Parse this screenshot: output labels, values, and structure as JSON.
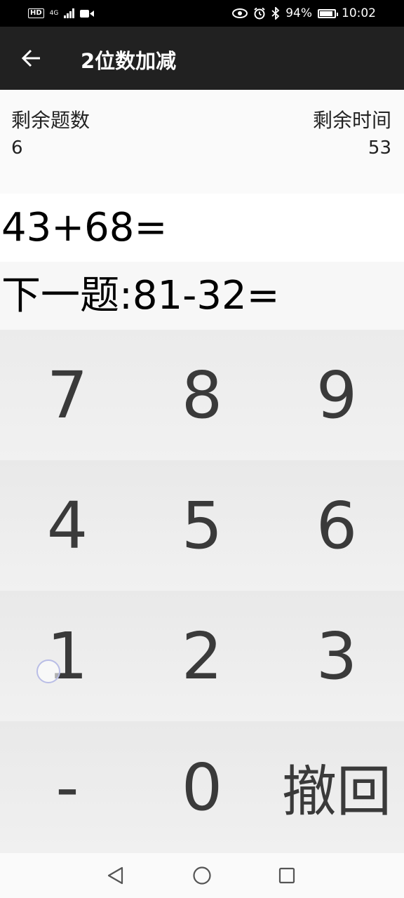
{
  "status_bar": {
    "hd": "HD",
    "network": "4G",
    "battery": "94%",
    "time": "10:02",
    "icons": [
      "signal-icon",
      "video-icon",
      "eye-icon",
      "alarm-icon",
      "bluetooth-icon",
      "battery-icon"
    ]
  },
  "toolbar": {
    "title": "2位数加减",
    "back_icon": "arrow-left-icon"
  },
  "info": {
    "remaining_questions_label": "剩余题数",
    "remaining_questions_value": "6",
    "remaining_time_label": "剩余时间",
    "remaining_time_value": "53"
  },
  "question": {
    "current": "43+68=",
    "next": "下一题:81-32="
  },
  "keypad": {
    "rows": [
      [
        "7",
        "8",
        "9"
      ],
      [
        "4",
        "5",
        "6"
      ],
      [
        "1",
        "2",
        "3"
      ],
      [
        "-",
        "0",
        "撤回"
      ]
    ]
  },
  "nav_bar": {
    "icons": [
      "back-triangle-icon",
      "home-circle-icon",
      "recents-square-icon"
    ]
  },
  "colors": {
    "toolbar_bg": "#212121",
    "status_bg": "#000000",
    "key_text": "#3a3a3a"
  }
}
